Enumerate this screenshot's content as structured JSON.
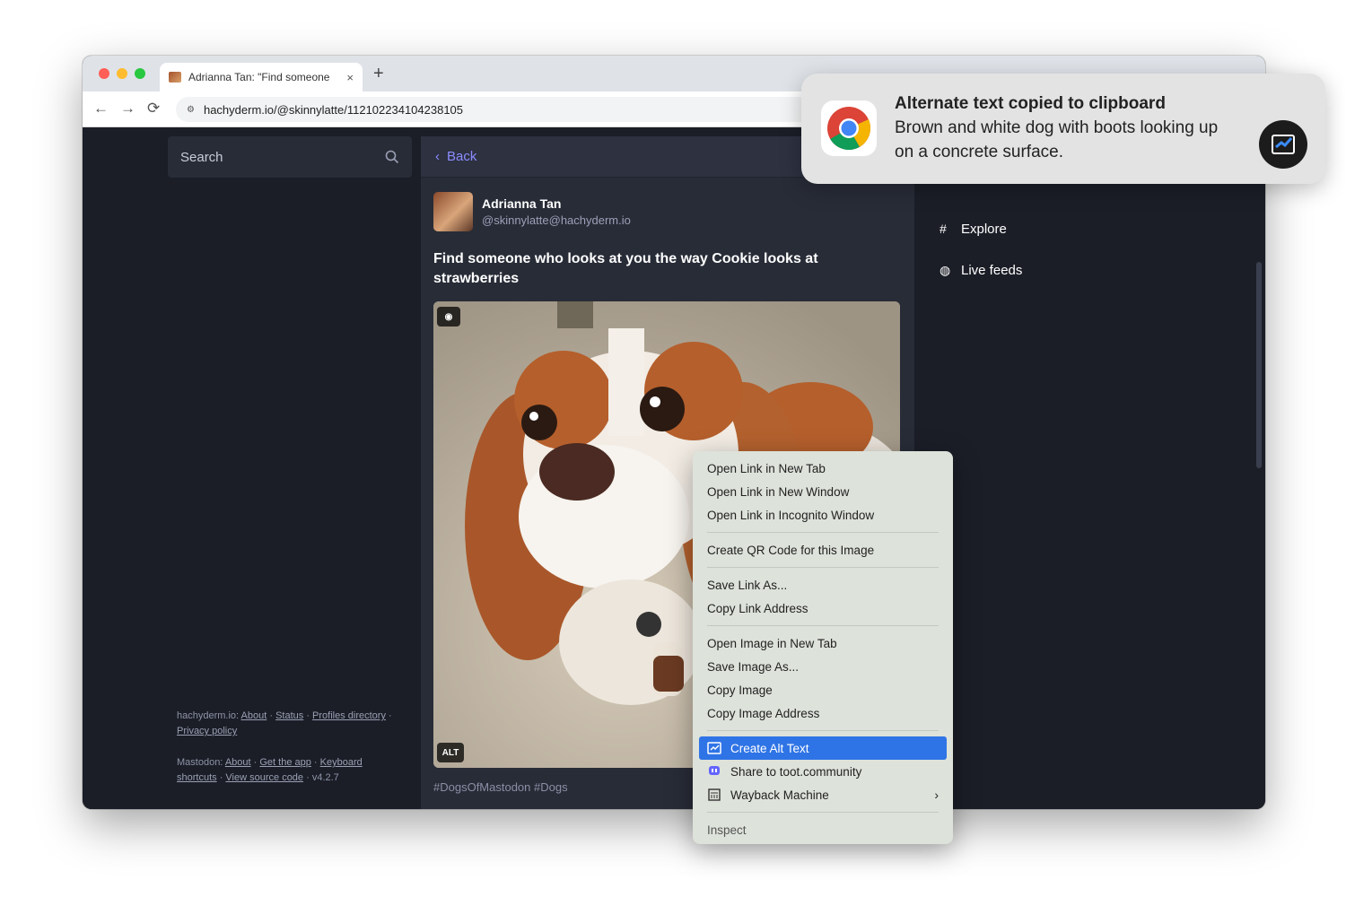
{
  "browser": {
    "tab_title": "Adrianna Tan: \"Find someone",
    "tab_close": "×",
    "new_tab": "+",
    "url": "hachyderm.io/@skinnylatte/112102234104238105",
    "back_icon": "←",
    "forward_icon": "→",
    "reload_icon": "⟳"
  },
  "sidebar": {
    "search_placeholder": "Search",
    "footer": {
      "instance_name": "hachyderm.io:",
      "instance_links": [
        "About",
        "Status",
        "Profiles directory",
        "Privacy policy"
      ],
      "mastodon_label": "Mastodon:",
      "mastodon_links": [
        "About",
        "Get the app",
        "Keyboard shortcuts",
        "View source code"
      ],
      "version": "v4.2.7"
    }
  },
  "column": {
    "back_label": "Back",
    "status": {
      "display_name": "Adrianna Tan",
      "handle": "@skinnylatte@hachyderm.io",
      "text": "Find someone who looks at you the way Cookie looks at strawberries",
      "alt_badge": "ALT",
      "hashtags": "#DogsOfMastodon #Dogs"
    }
  },
  "right_nav": {
    "items": [
      {
        "label": "Explore",
        "icon": "hashtag-icon"
      },
      {
        "label": "Live feeds",
        "icon": "globe-icon"
      }
    ]
  },
  "notification": {
    "title": "Alternate text copied to clipboard",
    "body": "Brown and white dog with boots looking up on a concrete surface."
  },
  "context_menu": {
    "group1": [
      "Open Link in New Tab",
      "Open Link in New Window",
      "Open Link in Incognito Window"
    ],
    "group2": [
      "Create QR Code for this Image"
    ],
    "group3": [
      "Save Link As...",
      "Copy Link Address"
    ],
    "group4": [
      "Open Image in New Tab",
      "Save Image As...",
      "Copy Image",
      "Copy Image Address"
    ],
    "group5": [
      "Create Alt Text",
      "Share to toot.community",
      "Wayback Machine"
    ],
    "group6": [
      "Inspect"
    ],
    "submenu_chevron": "›"
  },
  "colors": {
    "accent": "#8c8dff",
    "menu_highlight": "#2f74e6",
    "page_bg": "#1b1e27"
  }
}
